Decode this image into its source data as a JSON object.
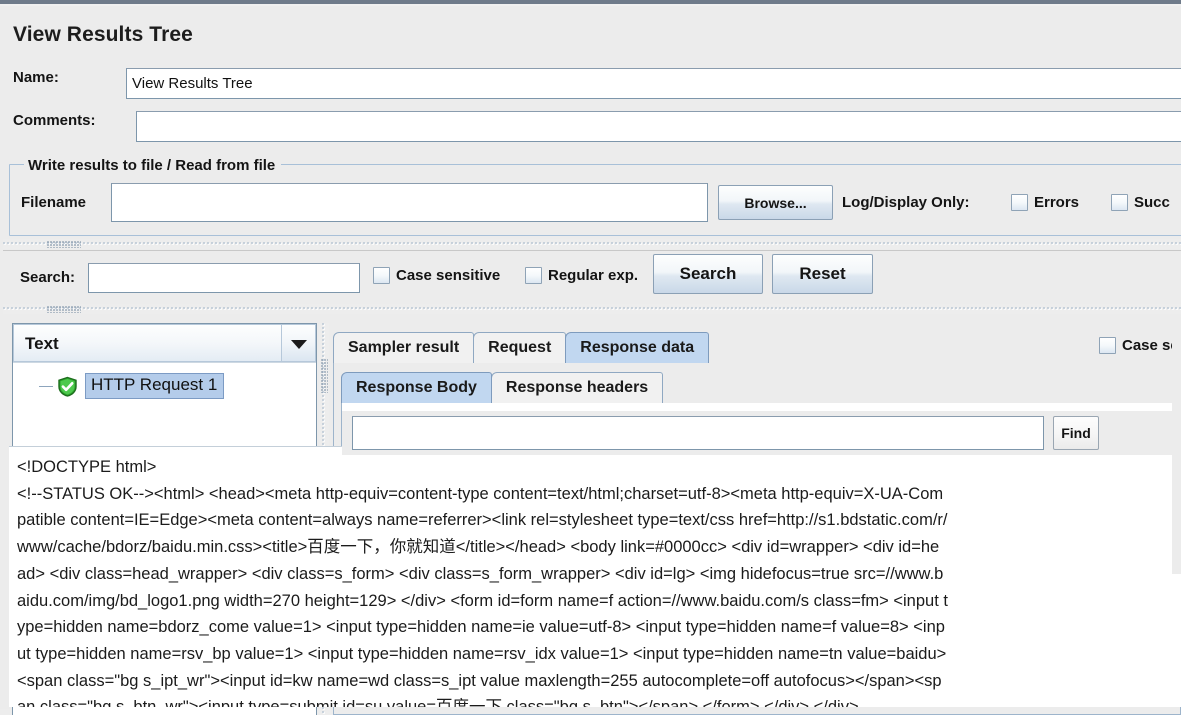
{
  "window": {
    "title": "View Results Tree"
  },
  "form": {
    "name_label": "Name:",
    "name_value": "View Results Tree",
    "comments_label": "Comments:",
    "comments_value": "",
    "comments_placeholder": ""
  },
  "file_group": {
    "title": "Write results to file / Read from file",
    "filename_label": "Filename",
    "filename_value": "",
    "browse_label": "Browse...",
    "log_display_label": "Log/Display Only:",
    "errors_label": "Errors",
    "errors_checked": false,
    "successes_label": "Succ",
    "successes_checked": false
  },
  "search_bar": {
    "search_label": "Search:",
    "search_value": "",
    "case_sensitive_label": "Case sensitive",
    "case_sensitive_checked": false,
    "regular_exp_label": "Regular exp.",
    "regular_exp_checked": false,
    "search_button": "Search",
    "reset_button": "Reset"
  },
  "tree_pane": {
    "renderer_selected": "Text",
    "renderer_arrow_icon": "chevron-down-icon",
    "node_label": "HTTP Request 1",
    "node_status_icon": "green-shield-check-icon"
  },
  "detail_pane": {
    "outer_tabs": [
      {
        "label": "Sampler result",
        "selected": false
      },
      {
        "label": "Request",
        "selected": false
      },
      {
        "label": "Response data",
        "selected": true
      }
    ],
    "inner_tabs": [
      {
        "label": "Response Body",
        "selected": true
      },
      {
        "label": "Response headers",
        "selected": false
      }
    ],
    "find_bar": {
      "find_value": "",
      "find_button": "Find",
      "case_label": "Case sen",
      "case_checked": false
    },
    "response_body_lines": [
      "<!DOCTYPE html>",
      "<!--STATUS OK--><html> <head><meta http-equiv=content-type content=text/html;charset=utf-8><meta http-equiv=X-UA-Com",
      "patible content=IE=Edge><meta content=always name=referrer><link rel=stylesheet type=text/css href=http://s1.bdstatic.com/r/",
      "www/cache/bdorz/baidu.min.css><title>百度一下，你就知道</title></head> <body link=#0000cc> <div id=wrapper> <div id=he",
      "ad> <div class=head_wrapper> <div class=s_form> <div class=s_form_wrapper> <div id=lg> <img hidefocus=true src=//www.b",
      "aidu.com/img/bd_logo1.png width=270 height=129> </div> <form id=form name=f action=//www.baidu.com/s class=fm> <input t",
      "ype=hidden name=bdorz_come value=1> <input type=hidden name=ie value=utf-8> <input type=hidden name=f value=8> <inp",
      "ut type=hidden name=rsv_bp value=1> <input type=hidden name=rsv_idx value=1> <input type=hidden name=tn value=baidu>",
      "<span class=\"bg s_ipt_wr\"><input id=kw name=wd class=s_ipt value maxlength=255 autocomplete=off autofocus></span><sp",
      "an class=\"bg s_btn_wr\"><input type=submit id=su value=百度一下 class=\"bg s_btn\"></span> </form> </div> </div>"
    ]
  },
  "colors": {
    "panel_bg": "#ececec",
    "tab_selected_bg": "#c1d7f0",
    "tree_selection_bg": "#b4ccea",
    "status_ok_green": "#2faa2f",
    "border_blue": "#9db4cb"
  }
}
